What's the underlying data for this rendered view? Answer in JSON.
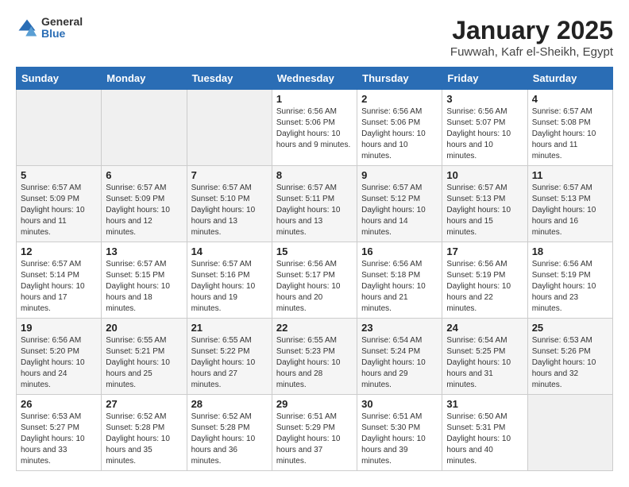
{
  "header": {
    "logo": {
      "general": "General",
      "blue": "Blue"
    },
    "title": "January 2025",
    "location": "Fuwwah, Kafr el-Sheikh, Egypt"
  },
  "weekdays": [
    "Sunday",
    "Monday",
    "Tuesday",
    "Wednesday",
    "Thursday",
    "Friday",
    "Saturday"
  ],
  "weeks": [
    [
      {
        "day": null
      },
      {
        "day": null
      },
      {
        "day": null
      },
      {
        "day": "1",
        "sunrise": "6:56 AM",
        "sunset": "5:06 PM",
        "daylight": "10 hours and 9 minutes."
      },
      {
        "day": "2",
        "sunrise": "6:56 AM",
        "sunset": "5:06 PM",
        "daylight": "10 hours and 10 minutes."
      },
      {
        "day": "3",
        "sunrise": "6:56 AM",
        "sunset": "5:07 PM",
        "daylight": "10 hours and 10 minutes."
      },
      {
        "day": "4",
        "sunrise": "6:57 AM",
        "sunset": "5:08 PM",
        "daylight": "10 hours and 11 minutes."
      }
    ],
    [
      {
        "day": "5",
        "sunrise": "6:57 AM",
        "sunset": "5:09 PM",
        "daylight": "10 hours and 11 minutes."
      },
      {
        "day": "6",
        "sunrise": "6:57 AM",
        "sunset": "5:09 PM",
        "daylight": "10 hours and 12 minutes."
      },
      {
        "day": "7",
        "sunrise": "6:57 AM",
        "sunset": "5:10 PM",
        "daylight": "10 hours and 13 minutes."
      },
      {
        "day": "8",
        "sunrise": "6:57 AM",
        "sunset": "5:11 PM",
        "daylight": "10 hours and 13 minutes."
      },
      {
        "day": "9",
        "sunrise": "6:57 AM",
        "sunset": "5:12 PM",
        "daylight": "10 hours and 14 minutes."
      },
      {
        "day": "10",
        "sunrise": "6:57 AM",
        "sunset": "5:13 PM",
        "daylight": "10 hours and 15 minutes."
      },
      {
        "day": "11",
        "sunrise": "6:57 AM",
        "sunset": "5:13 PM",
        "daylight": "10 hours and 16 minutes."
      }
    ],
    [
      {
        "day": "12",
        "sunrise": "6:57 AM",
        "sunset": "5:14 PM",
        "daylight": "10 hours and 17 minutes."
      },
      {
        "day": "13",
        "sunrise": "6:57 AM",
        "sunset": "5:15 PM",
        "daylight": "10 hours and 18 minutes."
      },
      {
        "day": "14",
        "sunrise": "6:57 AM",
        "sunset": "5:16 PM",
        "daylight": "10 hours and 19 minutes."
      },
      {
        "day": "15",
        "sunrise": "6:56 AM",
        "sunset": "5:17 PM",
        "daylight": "10 hours and 20 minutes."
      },
      {
        "day": "16",
        "sunrise": "6:56 AM",
        "sunset": "5:18 PM",
        "daylight": "10 hours and 21 minutes."
      },
      {
        "day": "17",
        "sunrise": "6:56 AM",
        "sunset": "5:19 PM",
        "daylight": "10 hours and 22 minutes."
      },
      {
        "day": "18",
        "sunrise": "6:56 AM",
        "sunset": "5:19 PM",
        "daylight": "10 hours and 23 minutes."
      }
    ],
    [
      {
        "day": "19",
        "sunrise": "6:56 AM",
        "sunset": "5:20 PM",
        "daylight": "10 hours and 24 minutes."
      },
      {
        "day": "20",
        "sunrise": "6:55 AM",
        "sunset": "5:21 PM",
        "daylight": "10 hours and 25 minutes."
      },
      {
        "day": "21",
        "sunrise": "6:55 AM",
        "sunset": "5:22 PM",
        "daylight": "10 hours and 27 minutes."
      },
      {
        "day": "22",
        "sunrise": "6:55 AM",
        "sunset": "5:23 PM",
        "daylight": "10 hours and 28 minutes."
      },
      {
        "day": "23",
        "sunrise": "6:54 AM",
        "sunset": "5:24 PM",
        "daylight": "10 hours and 29 minutes."
      },
      {
        "day": "24",
        "sunrise": "6:54 AM",
        "sunset": "5:25 PM",
        "daylight": "10 hours and 31 minutes."
      },
      {
        "day": "25",
        "sunrise": "6:53 AM",
        "sunset": "5:26 PM",
        "daylight": "10 hours and 32 minutes."
      }
    ],
    [
      {
        "day": "26",
        "sunrise": "6:53 AM",
        "sunset": "5:27 PM",
        "daylight": "10 hours and 33 minutes."
      },
      {
        "day": "27",
        "sunrise": "6:52 AM",
        "sunset": "5:28 PM",
        "daylight": "10 hours and 35 minutes."
      },
      {
        "day": "28",
        "sunrise": "6:52 AM",
        "sunset": "5:28 PM",
        "daylight": "10 hours and 36 minutes."
      },
      {
        "day": "29",
        "sunrise": "6:51 AM",
        "sunset": "5:29 PM",
        "daylight": "10 hours and 37 minutes."
      },
      {
        "day": "30",
        "sunrise": "6:51 AM",
        "sunset": "5:30 PM",
        "daylight": "10 hours and 39 minutes."
      },
      {
        "day": "31",
        "sunrise": "6:50 AM",
        "sunset": "5:31 PM",
        "daylight": "10 hours and 40 minutes."
      },
      {
        "day": null
      }
    ]
  ],
  "daylight_label": "Daylight hours",
  "sunrise_label": "Sunrise:",
  "sunset_label": "Sunset:"
}
